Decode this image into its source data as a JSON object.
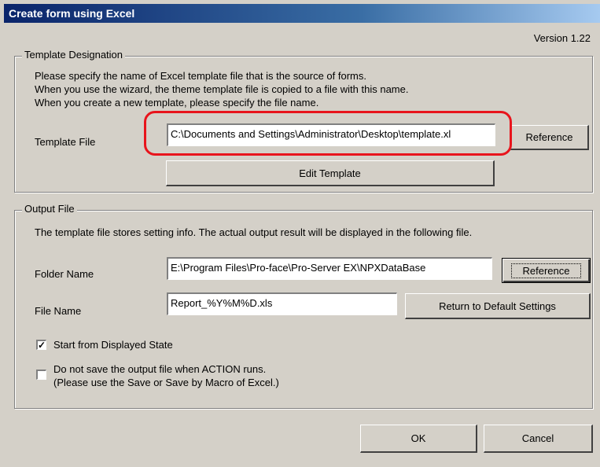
{
  "window": {
    "title": "Create form using Excel",
    "version": "Version 1.22"
  },
  "template_group": {
    "label": "Template Designation",
    "description": [
      "Please specify the name of Excel template file that is the source of forms.",
      "When you use the wizard, the theme template file is copied to a file with this name.",
      "When you create a new template, please specify the file name."
    ],
    "template_file_label": "Template File",
    "template_file_value": "C:\\Documents and Settings\\Administrator\\Desktop\\template.xl",
    "reference_button": "Reference",
    "edit_template_button": "Edit Template"
  },
  "output_group": {
    "label": "Output File",
    "description": "The template file stores setting info. The actual output result will be displayed in the following file.",
    "folder_name_label": "Folder Name",
    "folder_name_value": "E:\\Program Files\\Pro-face\\Pro-Server EX\\NPXDataBase",
    "reference_button": "Reference",
    "file_name_label": "File Name",
    "file_name_value": "Report_%Y%M%D.xls",
    "default_settings_button": "Return to Default Settings",
    "start_checkbox": {
      "label": "Start from Displayed State",
      "checked": true
    },
    "nosave_checkbox": {
      "label_line1": "Do not save the output file when ACTION runs.",
      "label_line2": "(Please use the Save or Save by Macro of Excel.)",
      "checked": false
    }
  },
  "footer": {
    "ok_button": "OK",
    "cancel_button": "Cancel"
  },
  "annotation": {
    "color": "#e8141c"
  }
}
